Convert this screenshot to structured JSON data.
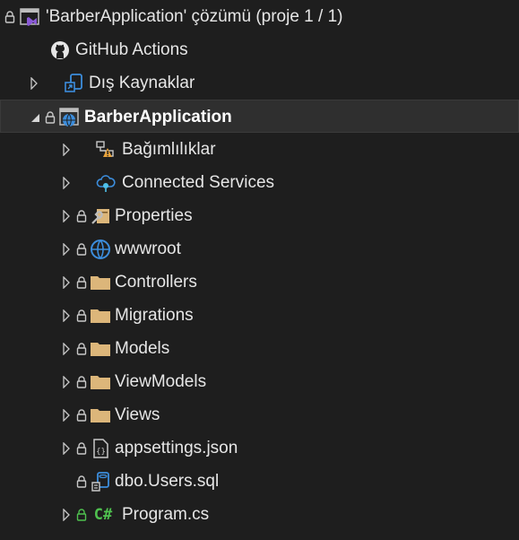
{
  "solution_explorer": {
    "solution_label": "'BarberApplication' çözümü (proje 1 / 1)",
    "github_actions": "GitHub Actions",
    "external_sources": "Dış Kaynaklar",
    "project": {
      "name": "BarberApplication",
      "items": [
        {
          "label": "Bağımlılıklar",
          "icon": "dependencies-icon"
        },
        {
          "label": "Connected Services",
          "icon": "connected-services-icon"
        },
        {
          "label": "Properties",
          "icon": "properties-icon"
        },
        {
          "label": "wwwroot",
          "icon": "globe-icon"
        },
        {
          "label": "Controllers",
          "icon": "folder-icon"
        },
        {
          "label": "Migrations",
          "icon": "folder-icon"
        },
        {
          "label": "Models",
          "icon": "folder-icon"
        },
        {
          "label": "ViewModels",
          "icon": "folder-icon"
        },
        {
          "label": "Views",
          "icon": "folder-icon"
        },
        {
          "label": "appsettings.json",
          "icon": "json-file-icon"
        },
        {
          "label": "dbo.Users.sql",
          "icon": "sql-file-icon"
        },
        {
          "label": "Program.cs",
          "icon": "csharp-file-icon"
        }
      ]
    },
    "csharp_glyph": "C#",
    "json_glyph": "{}"
  },
  "colors": {
    "background": "#1e1e1e",
    "selected_row": "#2f2f2f",
    "folder": "#dcb67a",
    "vs_purple": "#8a5ad6",
    "blue": "#3c8ddc",
    "csharp_green": "#4fc14f"
  }
}
